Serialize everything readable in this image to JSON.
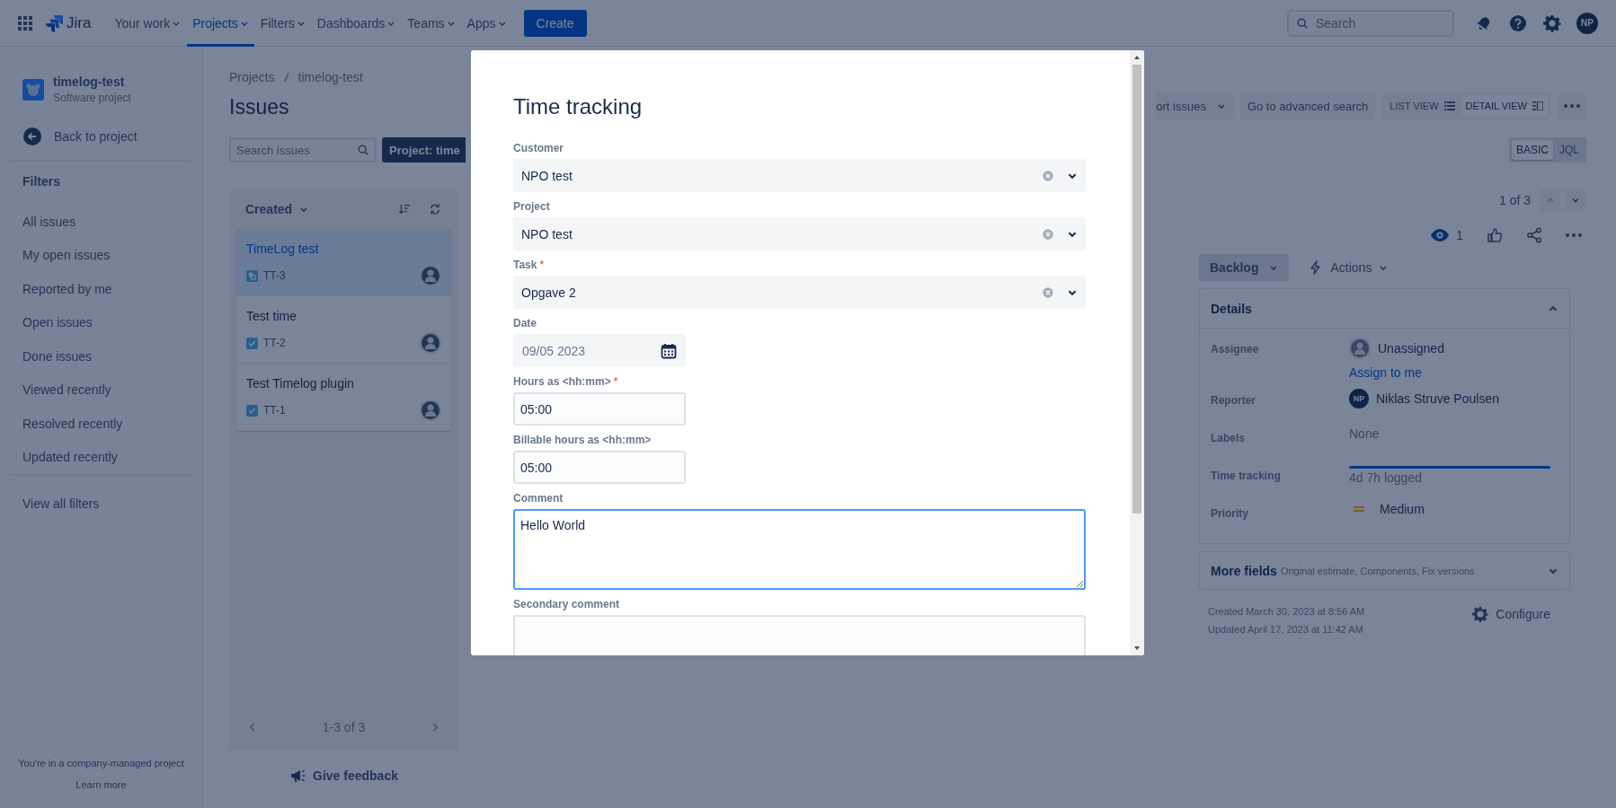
{
  "nav": {
    "logo": "Jira",
    "items": [
      {
        "label": "Your work",
        "selected": false
      },
      {
        "label": "Projects",
        "selected": true
      },
      {
        "label": "Filters",
        "selected": false
      },
      {
        "label": "Dashboards",
        "selected": false
      },
      {
        "label": "Teams",
        "selected": false
      },
      {
        "label": "Apps",
        "selected": false
      }
    ],
    "create": "Create",
    "search": {
      "placeholder": "Search"
    },
    "avatar": "NP"
  },
  "sidebar": {
    "project_name": "timelog-test",
    "project_type": "Software project",
    "back": "Back to project",
    "filters_heading": "Filters",
    "filters": [
      "All issues",
      "My open issues",
      "Reported by me",
      "Open issues",
      "Done issues",
      "Viewed recently",
      "Resolved recently",
      "Updated recently"
    ],
    "view_all": "View all filters",
    "footer_note": "You're in a company-managed project",
    "footer_link": "Learn more"
  },
  "breadcrumbs": [
    "Projects",
    "timelog-test"
  ],
  "page_title": "Issues",
  "search_issues": {
    "placeholder": "Search issues"
  },
  "project_filter": "Project: time",
  "toolbar": {
    "import": "ort issues",
    "advanced": "Go to advanced search",
    "views": [
      {
        "label": "LIST VIEW",
        "kind": "list",
        "selected": false
      },
      {
        "label": "DETAIL VIEW",
        "kind": "detail",
        "selected": true
      }
    ]
  },
  "query_modes": [
    {
      "label": "BASIC",
      "selected": true
    },
    {
      "label": "JQL",
      "selected": false
    }
  ],
  "issue_list": {
    "sort": "Created",
    "issues": [
      {
        "title": "TimeLog test",
        "key": "TT-3",
        "kind": "subtask",
        "selected": true
      },
      {
        "title": "Test time",
        "key": "TT-2",
        "kind": "task",
        "selected": false
      },
      {
        "title": "Test Timelog plugin",
        "key": "TT-1",
        "kind": "task",
        "selected": false
      }
    ],
    "pagination": "1-3 of 3"
  },
  "feedback": "Give feedback",
  "issue_nav": "1 of 3",
  "watchers": "1",
  "status": "Backlog",
  "actions": "Actions",
  "details": {
    "heading": "Details",
    "expanded": true,
    "fields": [
      {
        "label": "Assignee",
        "kind": "assignee",
        "value": "Unassigned",
        "link": "Assign to me"
      },
      {
        "label": "Reporter",
        "kind": "reporter",
        "initials": "NP",
        "value": "Niklas Struve Poulsen"
      },
      {
        "label": "Labels",
        "kind": "text",
        "value": "None"
      },
      {
        "label": "Time tracking",
        "kind": "progress",
        "level": 1,
        "value": "4d 7h logged"
      },
      {
        "label": "Priority",
        "kind": "priority",
        "value": "Medium"
      }
    ]
  },
  "more_fields": {
    "heading": "More fields",
    "hint": "Original estimate, Components, Fix versions",
    "expanded": false
  },
  "created": "Created March 30, 2023 at 8:56 AM",
  "updated": "Updated April 17, 2023 at 11:42 AM",
  "configure": "Configure",
  "modal": {
    "title": "Time tracking",
    "fields": [
      {
        "kind": "select",
        "label": "Customer",
        "value": "NPO test"
      },
      {
        "kind": "select",
        "label": "Project",
        "value": "NPO test"
      },
      {
        "kind": "select",
        "label": "Task",
        "required_mark": "*",
        "value": "Opgave 2"
      },
      {
        "kind": "date",
        "label": "Date",
        "value": "09/05 2023"
      },
      {
        "kind": "input",
        "label": "Hours as <hh:mm>",
        "required_mark": "*",
        "value": "05:00"
      },
      {
        "kind": "input",
        "label": "Billable hours as <hh:mm>",
        "value": "05:00"
      },
      {
        "kind": "textarea",
        "label": "Comment",
        "value": "Hello World",
        "focused": true
      },
      {
        "kind": "textarea",
        "label": "Secondary comment",
        "focused": false
      }
    ]
  }
}
